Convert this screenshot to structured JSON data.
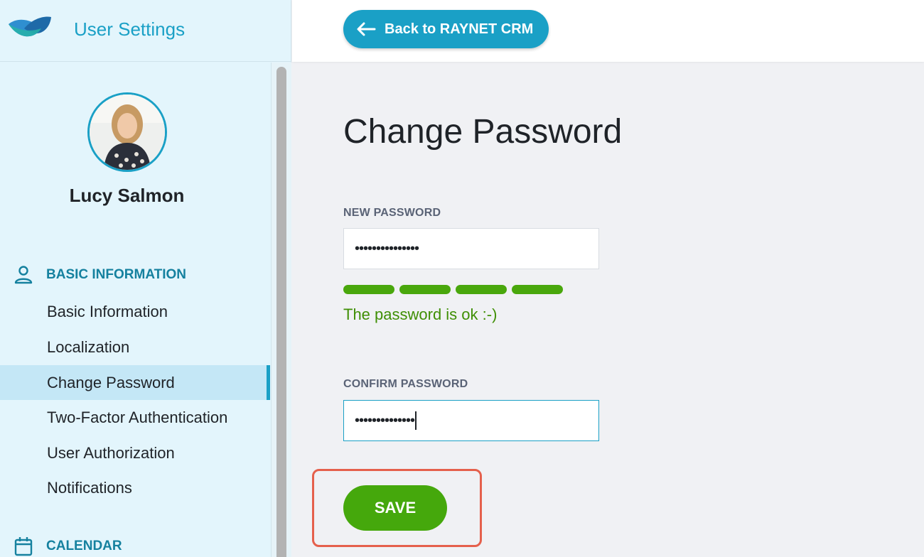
{
  "brand": {
    "title": "User Settings",
    "logo_icon": "raynet-logo-icon"
  },
  "user": {
    "name": "Lucy Salmon",
    "avatar": "user-avatar-photo"
  },
  "sidebar": {
    "sections": [
      {
        "label": "BASIC INFORMATION",
        "icon": "person-icon"
      },
      {
        "label": "CALENDAR",
        "icon": "calendar-icon"
      }
    ],
    "items": [
      {
        "label": "Basic Information"
      },
      {
        "label": "Localization"
      },
      {
        "label": "Change Password",
        "active": true
      },
      {
        "label": "Two-Factor Authentication"
      },
      {
        "label": "User Authorization"
      },
      {
        "label": "Notifications"
      }
    ]
  },
  "topbar": {
    "back_label": "Back to RAYNET CRM",
    "back_icon": "arrow-left-icon"
  },
  "main": {
    "title": "Change Password",
    "new_password": {
      "label": "NEW PASSWORD",
      "value": "•••••••••••••••"
    },
    "strength": {
      "segments_filled": 4,
      "segments_total": 4,
      "message": "The password is ok :-)"
    },
    "confirm_password": {
      "label": "CONFIRM PASSWORD",
      "value": "••••••••••••••"
    },
    "save_label": "SAVE"
  },
  "colors": {
    "accent": "#1aa0c6",
    "success": "#45a80c",
    "highlight": "#e5604c"
  }
}
